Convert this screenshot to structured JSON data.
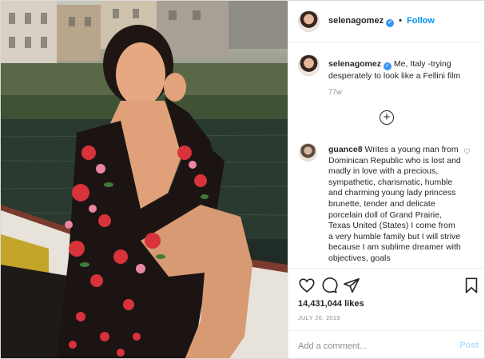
{
  "post": {
    "author": {
      "username": "selenagomez",
      "verified_icon": "verified-badge-icon",
      "follow_label": "Follow",
      "separator": "•"
    },
    "caption": {
      "username": "selenagomez",
      "text": "Me, Italy -trying desperately to look like a Fellini film",
      "time_ago": "77w"
    },
    "load_more_icon": "plus-circle-icon",
    "comments": [
      {
        "username": "guance8",
        "text": "Writes a young man from Dominican Republic who is lost and madly in love with a precious, sympathetic, charismatic, humble and charming young lady princess brunette, tender and delicate porcelain doll of Grand Prairie, Texas United (States) I come from a very humble family but I will strive because I am sublime dreamer with objectives, goals"
      }
    ],
    "actions": {
      "icons": [
        "heart-icon",
        "comment-icon",
        "share-icon",
        "bookmark-icon"
      ]
    },
    "likes": "14,431,044 likes",
    "date": "JULY 26, 2019",
    "add_comment": {
      "placeholder": "Add a comment...",
      "post_label": "Post"
    },
    "colors": {
      "accent": "#0095f6",
      "post_disabled": "#b2dffc",
      "muted": "#8e8e8e"
    }
  }
}
